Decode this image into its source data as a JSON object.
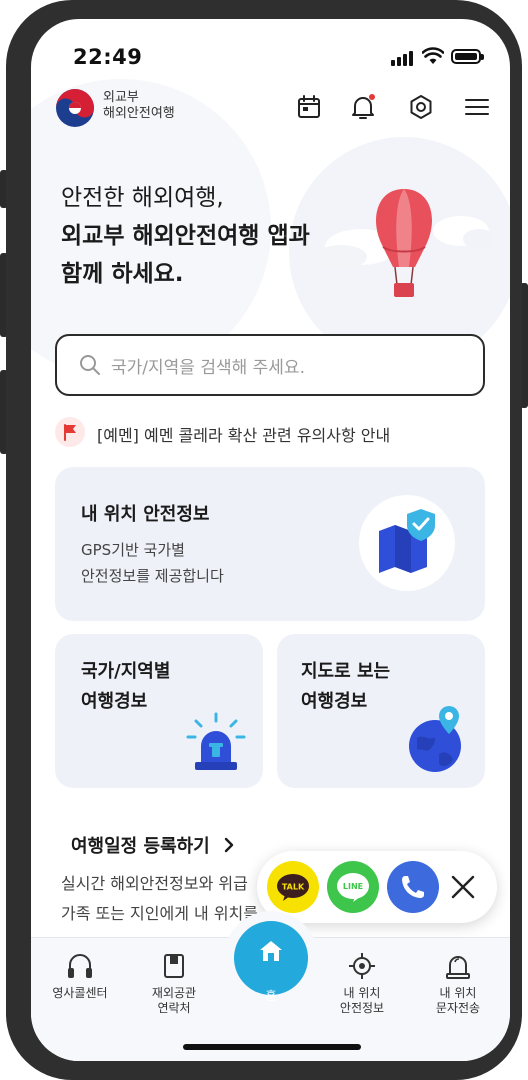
{
  "status_bar": {
    "time": "22:49"
  },
  "header": {
    "brand_line1": "외교부",
    "brand_line2": "해외안전여행",
    "icons": [
      "calendar-icon",
      "bell-icon",
      "settings-icon",
      "menu-icon"
    ]
  },
  "hero": {
    "line1": "안전한 해외여행,",
    "line2": "외교부 해외안전여행 앱과",
    "line3": "함께 하세요."
  },
  "search": {
    "placeholder": "국가/지역을 검색해 주세요."
  },
  "notice": {
    "text": "[예멘] 예멘 콜레라 확산 관련 유의사항 안내"
  },
  "cards": {
    "location_safety": {
      "title": "내 위치 안전정보",
      "desc_line1": "GPS기반 국가별",
      "desc_line2": "안전정보를 제공합니다"
    },
    "country_alert": {
      "title_line1": "국가/지역별",
      "title_line2": "여행경보"
    },
    "map_alert": {
      "title_line1": "지도로 보는",
      "title_line2": "여행경보"
    }
  },
  "schedule": {
    "title": "여행일정 등록하기",
    "desc_line1": "실시간 해외안전정보와 위급",
    "desc_line2": "가족 또는 지인에게 내 위치를"
  },
  "share": {
    "kakao_label": "TALK",
    "line_label": "LINE"
  },
  "bottom_nav": {
    "consular": "영사콜센터",
    "embassy_line1": "재외공관",
    "embassy_line2": "연락처",
    "home": "홈",
    "my_loc_line1": "내 위치",
    "my_loc_line2": "안전정보",
    "sms_line1": "내 위치",
    "sms_line2": "문자전송"
  },
  "colors": {
    "accent": "#24a9dc",
    "card_bg": "#eef1f8",
    "kakao": "#f7e100",
    "line": "#3ec54c",
    "call": "#3d6bde",
    "notice_flag": "#e53935"
  }
}
